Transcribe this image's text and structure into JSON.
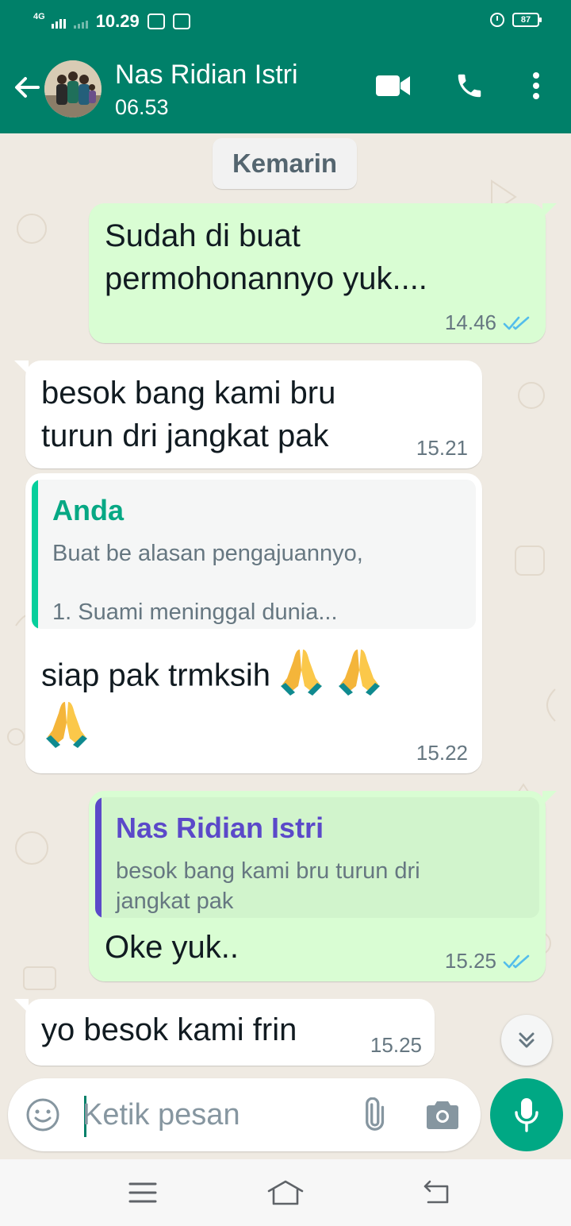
{
  "status_bar": {
    "network": "4G",
    "time": "10.29",
    "battery": "87"
  },
  "header": {
    "contact_name": "Nas Ridian Istri",
    "last_seen": "06.53"
  },
  "chat": {
    "date_chip": "Kemarin",
    "messages": [
      {
        "direction": "out",
        "lines": [
          "Sudah di buat",
          "permohonannyo yuk...."
        ],
        "time": "14.46",
        "status": "read"
      },
      {
        "direction": "in",
        "lines": [
          "besok bang kami bru",
          "turun dri jangkat pak"
        ],
        "time": "15.21"
      },
      {
        "direction": "in",
        "quote": {
          "author": "Anda",
          "line1": "Buat be alasan pengajuannyo,",
          "line2": "1. Suami meninggal dunia..."
        },
        "text": "siap pak trmksih",
        "emoji": "folded-hands",
        "emoji_count": 3,
        "time": "15.22"
      },
      {
        "direction": "out",
        "quote": {
          "author": "Nas Ridian Istri",
          "line1": "besok bang kami bru turun dri",
          "line2": "jangkat pak"
        },
        "text": "Oke yuk..",
        "time": "15.25",
        "status": "read"
      },
      {
        "direction": "in",
        "text": "yo besok  kami frin",
        "time": "15.25"
      }
    ]
  },
  "composer": {
    "placeholder": "Ketik pesan"
  },
  "colors": {
    "header": "#008069",
    "outgoing_bubble": "#d9fdd3",
    "incoming_bubble": "#ffffff",
    "read_ticks": "#53bdeb",
    "quote_self": "#06cf9c",
    "quote_contact": "#5b49c9",
    "mic_button": "#00a884"
  },
  "icons": [
    "back-arrow",
    "video-call",
    "voice-call",
    "more-vert",
    "emoji",
    "attach",
    "camera",
    "mic",
    "scroll-down",
    "menu",
    "home",
    "back"
  ]
}
